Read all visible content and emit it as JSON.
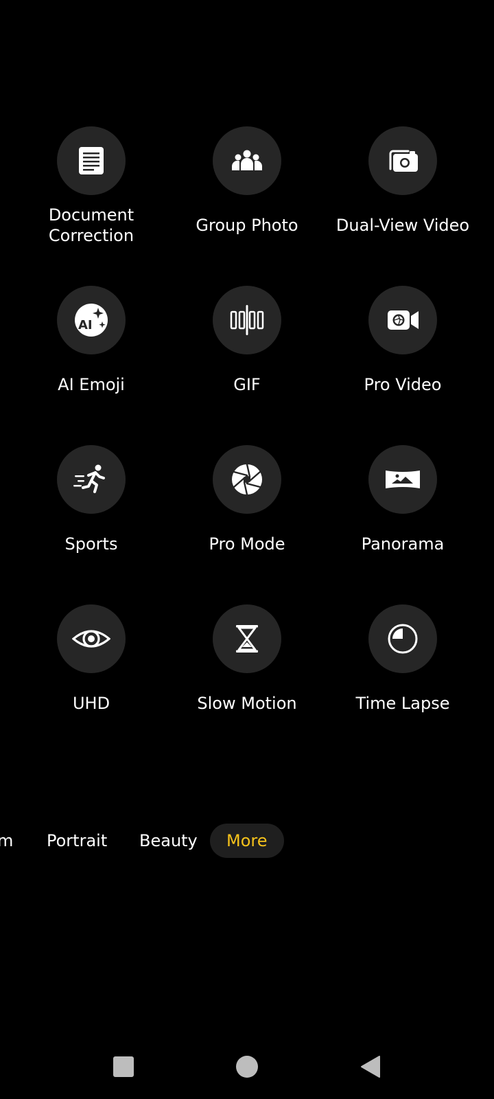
{
  "modes": [
    {
      "label": "Document\nCorrection",
      "icon": "document-icon"
    },
    {
      "label": "Group Photo",
      "icon": "group-people-icon"
    },
    {
      "label": "Dual-View Video",
      "icon": "dual-camera-icon"
    },
    {
      "label": "AI Emoji",
      "icon": "ai-emoji-icon"
    },
    {
      "label": "GIF",
      "icon": "gif-frames-icon"
    },
    {
      "label": "Pro Video",
      "icon": "video-camera-icon"
    },
    {
      "label": "Sports",
      "icon": "running-person-icon"
    },
    {
      "label": "Pro Mode",
      "icon": "aperture-icon"
    },
    {
      "label": "Panorama",
      "icon": "panorama-landscape-icon"
    },
    {
      "label": "UHD",
      "icon": "eye-icon"
    },
    {
      "label": "Slow Motion",
      "icon": "hourglass-icon"
    },
    {
      "label": "Time Lapse",
      "icon": "clock-icon"
    }
  ],
  "mode_bar": {
    "partial": "m",
    "portrait": "Portrait",
    "beauty": "Beauty",
    "more": "More",
    "active_color": "#f5c21b"
  },
  "nav": {
    "recents": "square-icon",
    "home": "circle-icon",
    "back": "triangle-back-icon"
  }
}
